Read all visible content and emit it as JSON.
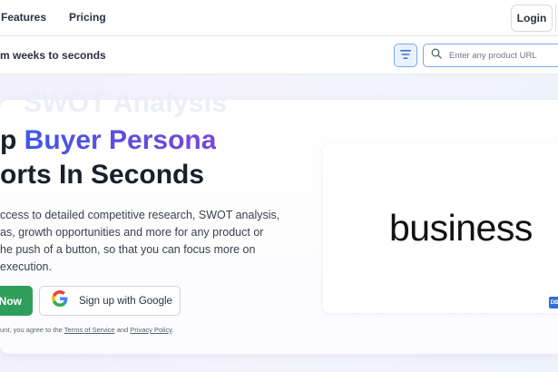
{
  "nav": {
    "features": "Features",
    "pricing": "Pricing",
    "login": "Login"
  },
  "subbar": {
    "tagline": "m weeks to seconds",
    "search_placeholder": "Enter any product URL",
    "filter_icon": "filter-lines-icon",
    "search_icon": "search-icon"
  },
  "hero": {
    "ghost_text": "SWOT Analysis",
    "headline_line1_prefix": "p ",
    "headline_line1_highlight": "Buyer Persona",
    "headline_line2": "orts In Seconds",
    "description_lines": [
      "ccess to detailed competitive research, SWOT analysis,",
      "as, growth opportunities and more for any product or",
      "he push of a button, so that you can focus more on",
      "execution."
    ],
    "start_button": "Now",
    "google_button": "Sign up with Google",
    "google_icon": "google-icon",
    "terms_prefix": "unt, you agree to the ",
    "terms_link": "Terms of Service",
    "terms_and": " and ",
    "privacy_link": "Privacy Policy",
    "terms_suffix": "."
  },
  "media": {
    "word": "business",
    "badge_text": "DB"
  },
  "colors": {
    "accent_blue": "#3f57e6",
    "accent_purple": "#7b46d8",
    "cta_green": "#2f9e5a",
    "outline_blue": "#7da6e8"
  }
}
